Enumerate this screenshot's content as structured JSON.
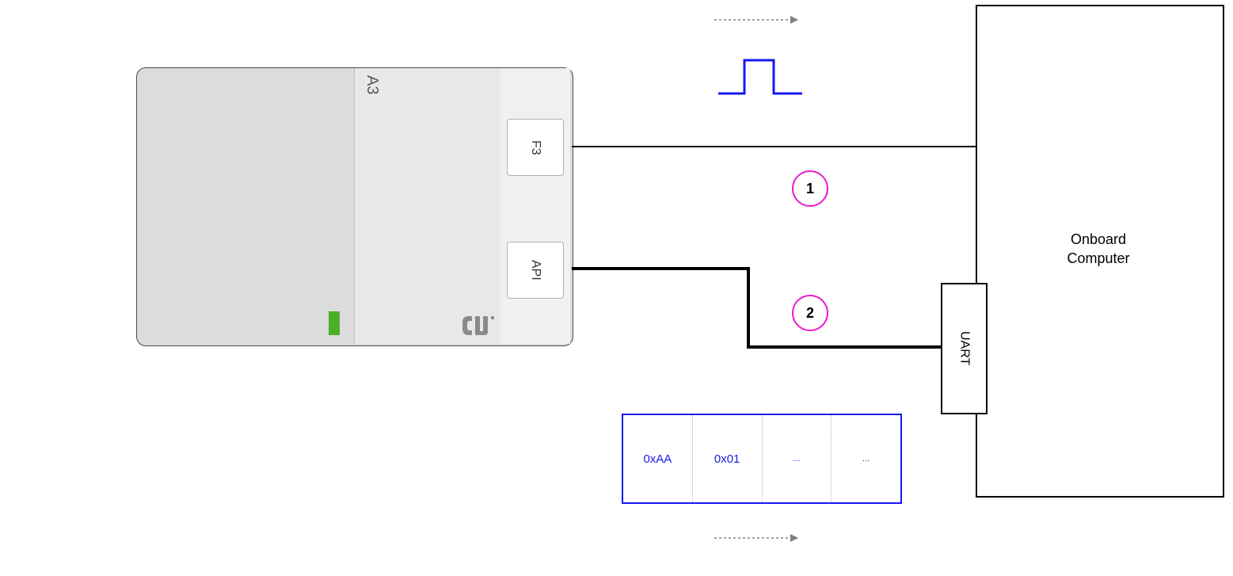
{
  "a3": {
    "label": "A3",
    "logo": "dji"
  },
  "ports": {
    "f3": "F3",
    "api": "API"
  },
  "onboard": {
    "label_line1": "Onboard",
    "label_line2": "Computer",
    "uart": "UART"
  },
  "circles": {
    "one": "1",
    "two": "2"
  },
  "packet": {
    "c0": "0xAA",
    "c1": "0x01",
    "c2": "...",
    "c3": "..."
  }
}
